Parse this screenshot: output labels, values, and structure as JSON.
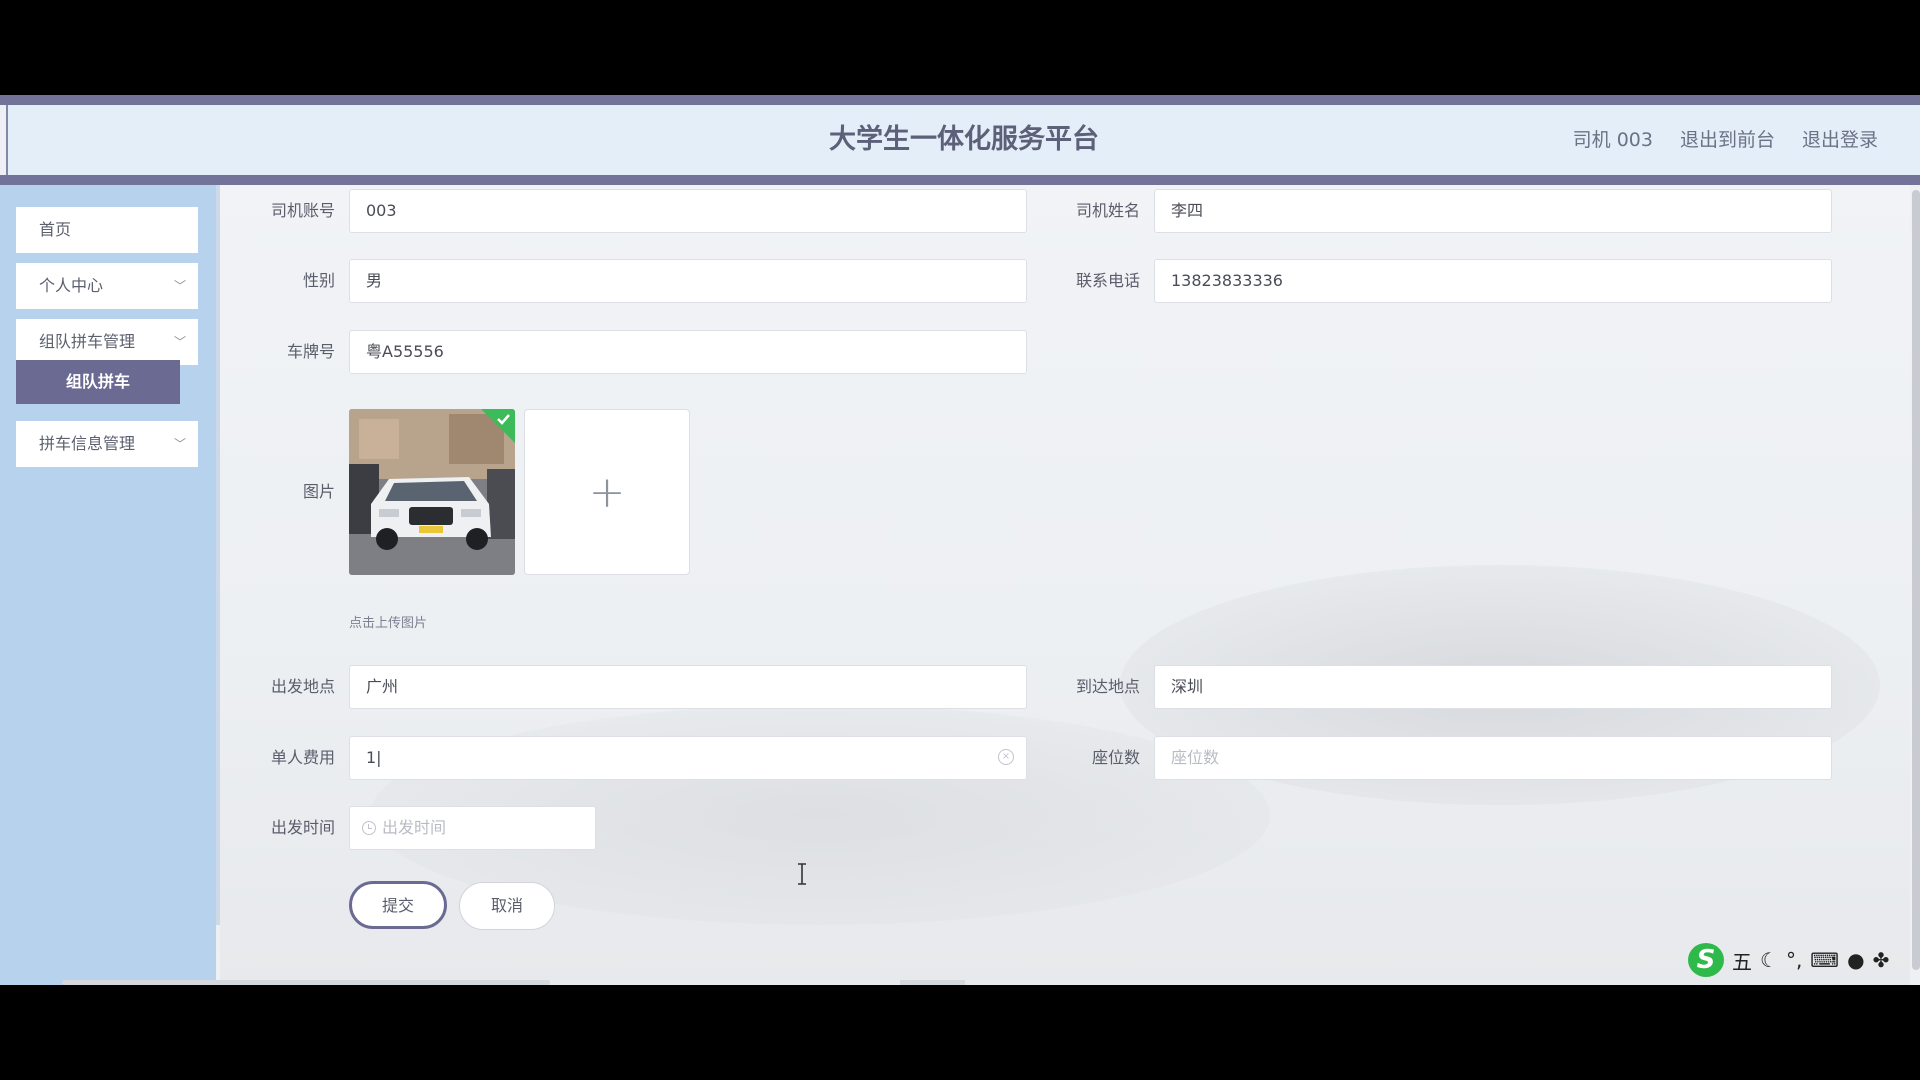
{
  "header": {
    "title": "大学生一体化服务平台",
    "user": "司机 003",
    "to_front": "退出到前台",
    "logout": "退出登录"
  },
  "sidebar": {
    "items": [
      {
        "label": "首页",
        "has_arrow": false
      },
      {
        "label": "个人中心",
        "has_arrow": true
      },
      {
        "label": "组队拼车管理",
        "has_arrow": true
      },
      {
        "label": "拼车信息管理",
        "has_arrow": true
      }
    ],
    "active_sub": "组队拼车"
  },
  "form": {
    "driver_account": {
      "label": "司机账号",
      "value": "003"
    },
    "driver_name": {
      "label": "司机姓名",
      "value": "李四"
    },
    "gender": {
      "label": "性别",
      "value": "男"
    },
    "phone": {
      "label": "联系电话",
      "value": "13823833336"
    },
    "plate": {
      "label": "车牌号",
      "value": "粤A55556"
    },
    "image": {
      "label": "图片",
      "hint": "点击上传图片"
    },
    "depart_place": {
      "label": "出发地点",
      "value": "广州"
    },
    "arrive_place": {
      "label": "到达地点",
      "value": "深圳"
    },
    "fee": {
      "label": "单人费用",
      "value": "1|"
    },
    "seats": {
      "label": "座位数",
      "placeholder": "座位数"
    },
    "depart_time": {
      "label": "出发时间",
      "placeholder": "出发时间"
    },
    "submit": "提交",
    "cancel": "取消"
  },
  "ime": {
    "mode": "五"
  }
}
